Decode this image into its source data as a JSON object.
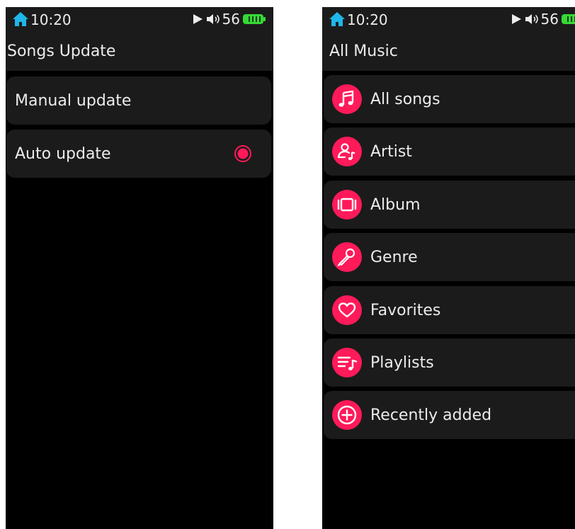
{
  "screens": [
    {
      "status": {
        "time": "10:20",
        "volume": "56"
      },
      "title": "Songs Update",
      "items": [
        {
          "label": "Manual update",
          "selected": false
        },
        {
          "label": "Auto update",
          "selected": true
        }
      ]
    },
    {
      "status": {
        "time": "10:20",
        "volume": "56"
      },
      "title": "All Music",
      "items": [
        {
          "label": "All songs",
          "icon": "music-note-icon"
        },
        {
          "label": "Artist",
          "icon": "artist-icon"
        },
        {
          "label": "Album",
          "icon": "album-icon"
        },
        {
          "label": "Genre",
          "icon": "microphone-icon"
        },
        {
          "label": "Favorites",
          "icon": "heart-icon"
        },
        {
          "label": "Playlists",
          "icon": "playlist-icon"
        },
        {
          "label": "Recently added",
          "icon": "plus-circle-icon"
        }
      ]
    }
  ],
  "colors": {
    "accent": "#ff1a5a",
    "home_icon": "#1fb6e8",
    "battery": "#35d935",
    "row_bg": "#1b1b1b",
    "screen_bg": "#000000"
  }
}
